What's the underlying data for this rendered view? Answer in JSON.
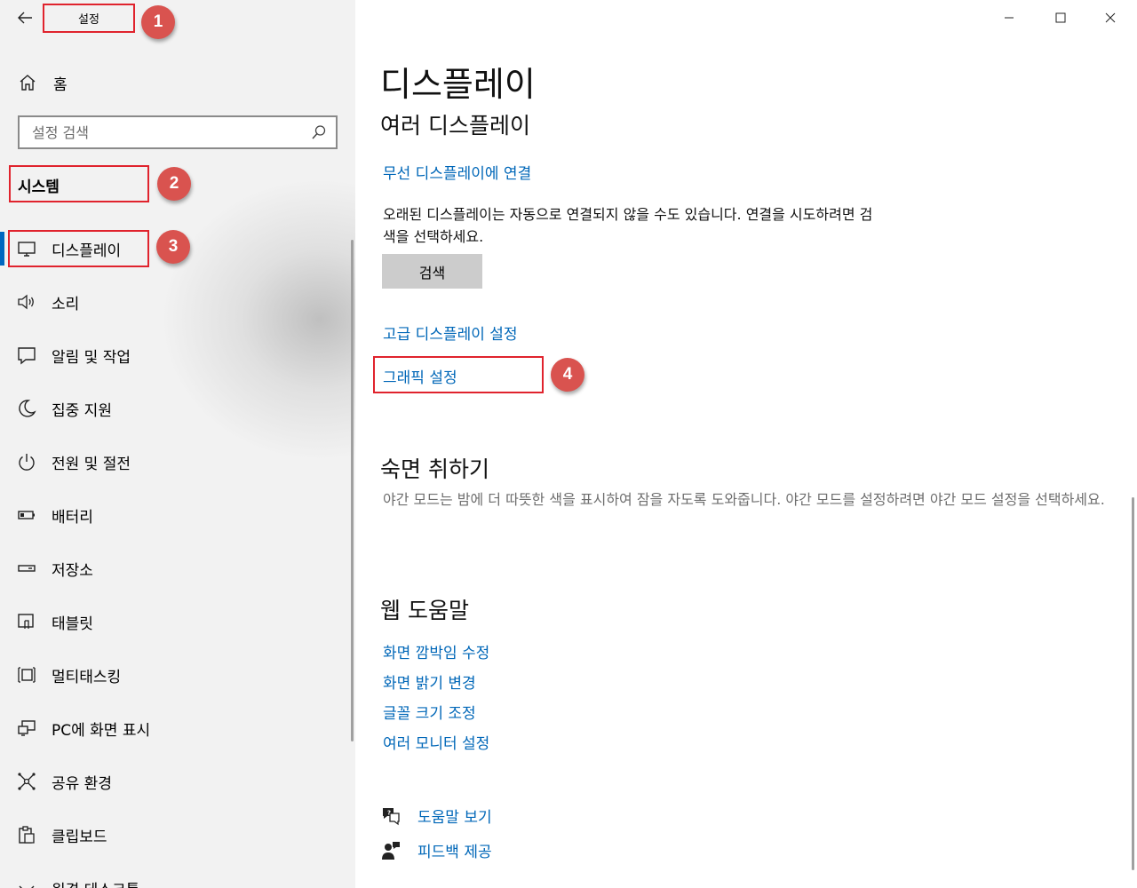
{
  "window": {
    "app_title": "설정",
    "back_icon": "back-arrow-icon"
  },
  "sidebar": {
    "home_label": "홈",
    "search_placeholder": "설정 검색",
    "section_title": "시스템",
    "items": [
      {
        "label": "디스플레이",
        "icon": "monitor-icon",
        "active": true
      },
      {
        "label": "소리",
        "icon": "speaker-icon"
      },
      {
        "label": "알림 및 작업",
        "icon": "notification-icon"
      },
      {
        "label": "집중 지원",
        "icon": "moon-icon"
      },
      {
        "label": "전원 및 절전",
        "icon": "power-icon"
      },
      {
        "label": "배터리",
        "icon": "battery-icon"
      },
      {
        "label": "저장소",
        "icon": "storage-icon"
      },
      {
        "label": "태블릿",
        "icon": "tablet-icon"
      },
      {
        "label": "멀티태스킹",
        "icon": "multitasking-icon"
      },
      {
        "label": "PC에 화면 표시",
        "icon": "project-icon"
      },
      {
        "label": "공유 환경",
        "icon": "share-icon"
      },
      {
        "label": "클립보드",
        "icon": "clipboard-icon"
      },
      {
        "label": "원격 데스크톱",
        "icon": "remote-desktop-icon"
      }
    ]
  },
  "annotations": [
    "1",
    "2",
    "3",
    "4"
  ],
  "main": {
    "page_title": "디스플레이",
    "multi_display": {
      "heading": "여러 디스플레이",
      "wireless_link": "무선 디스플레이에 연결",
      "description": "오래된 디스플레이는 자동으로 연결되지 않을 수도 있습니다. 연결을 시도하려면 검색을 선택하세요.",
      "detect_button": "검색",
      "advanced_link": "고급 디스플레이 설정",
      "graphics_link": "그래픽 설정"
    },
    "sleep": {
      "heading": "숙면 취하기",
      "description": "야간 모드는 밤에 더 따뜻한 색을 표시하여 잠을 자도록 도와줍니다. 야간 모드를 설정하려면 야간 모드 설정을 선택하세요."
    },
    "web_help": {
      "heading": "웹 도움말",
      "links": [
        "화면 깜박임 수정",
        "화면 밝기 변경",
        "글꼴 크기 조정",
        "여러 모니터 설정"
      ]
    },
    "get_help": "도움말 보기",
    "feedback": "피드백 제공"
  },
  "colors": {
    "accent": "#0067c0",
    "link": "#0067b8",
    "annotation_red": "#e0232d",
    "badge": "#d9534f"
  }
}
